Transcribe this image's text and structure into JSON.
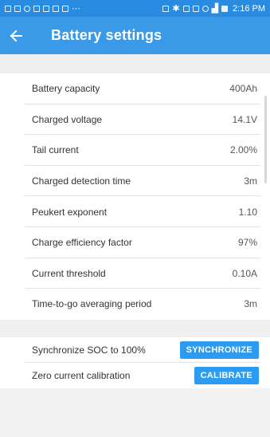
{
  "status_bar": {
    "time": "2:16 PM",
    "icons": [
      "notification-icons",
      "bluetooth-icon",
      "nfc-icon",
      "wifi-icon",
      "signal-icon",
      "battery-icon"
    ]
  },
  "app_bar": {
    "title": "Battery settings",
    "back_icon": "arrow-left-icon"
  },
  "settings": [
    {
      "label": "Battery capacity",
      "value": "400Ah"
    },
    {
      "label": "Charged voltage",
      "value": "14.1V"
    },
    {
      "label": "Tail current",
      "value": "2.00%"
    },
    {
      "label": "Charged detection time",
      "value": "3m"
    },
    {
      "label": "Peukert exponent",
      "value": "1.10"
    },
    {
      "label": "Charge efficiency factor",
      "value": "97%"
    },
    {
      "label": "Current threshold",
      "value": "0.10A"
    },
    {
      "label": "Time-to-go averaging period",
      "value": "3m"
    }
  ],
  "actions": [
    {
      "label": "Synchronize SOC to 100%",
      "button": "SYNCHRONIZE"
    },
    {
      "label": "Zero current calibration",
      "button": "CALIBRATE"
    }
  ],
  "colors": {
    "status_bar": "#2a8ce0",
    "app_bar": "#3a9ae8",
    "button": "#2d9cf0",
    "background": "#f2f2f2"
  }
}
